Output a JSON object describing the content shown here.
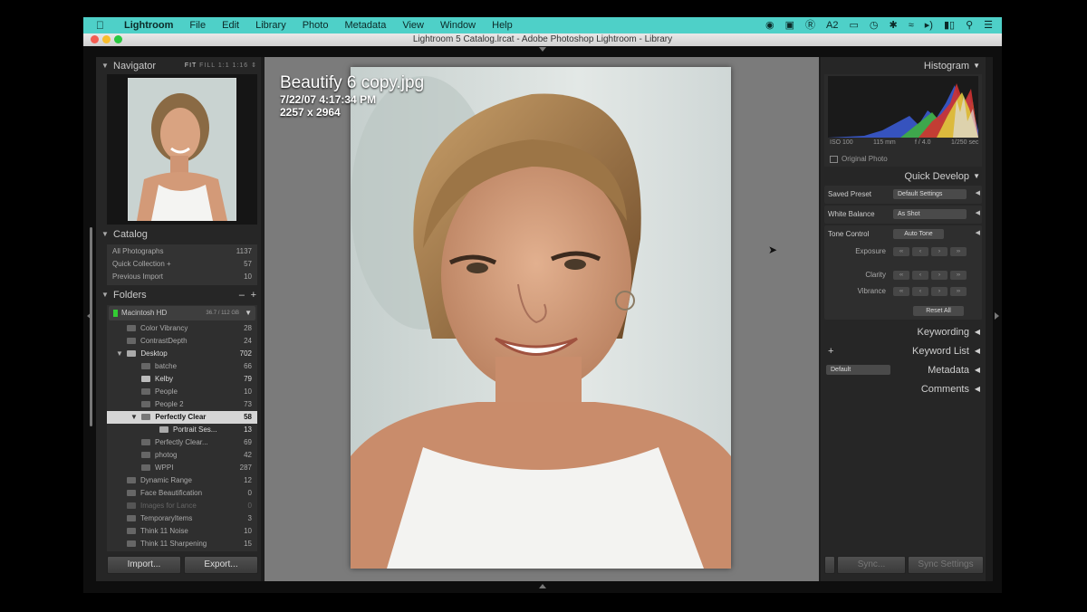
{
  "menubar": {
    "app": "Lightroom",
    "menus": [
      "File",
      "Edit",
      "Library",
      "Photo",
      "Metadata",
      "View",
      "Window",
      "Help"
    ],
    "status_number": "2"
  },
  "window": {
    "title": "Lightroom 5 Catalog.lrcat - Adobe Photoshop Lightroom - Library"
  },
  "navigator": {
    "title": "Navigator",
    "modes": [
      "FIT",
      "FILL",
      "1:1",
      "1:16"
    ]
  },
  "catalog": {
    "title": "Catalog",
    "items": [
      {
        "label": "All Photographs",
        "count": "1137"
      },
      {
        "label": "Quick Collection +",
        "count": "57"
      },
      {
        "label": "Previous Import",
        "count": "10"
      }
    ]
  },
  "folders": {
    "title": "Folders",
    "volume": {
      "label": "Macintosh HD",
      "size": "36.7 / 112 GB"
    },
    "items": [
      {
        "label": "Color Vibrancy",
        "count": "28"
      },
      {
        "label": "ContrastDepth",
        "count": "24"
      },
      {
        "label": "Desktop",
        "count": "702"
      },
      {
        "label": "batche",
        "count": "66"
      },
      {
        "label": "Kelby",
        "count": "79"
      },
      {
        "label": "People",
        "count": "10"
      },
      {
        "label": "People 2",
        "count": "73"
      },
      {
        "label": "Perfectly Clear",
        "count": "58"
      },
      {
        "label": "Portrait Ses...",
        "count": "13"
      },
      {
        "label": "Perfectly Clear...",
        "count": "69"
      },
      {
        "label": "photog",
        "count": "42"
      },
      {
        "label": "WPPI",
        "count": "287"
      },
      {
        "label": "Dynamic Range",
        "count": "12"
      },
      {
        "label": "Face Beautification",
        "count": "0"
      },
      {
        "label": "Images for Lance",
        "count": "0"
      },
      {
        "label": "TemporaryItems",
        "count": "3"
      },
      {
        "label": "Think 11 Noise",
        "count": "10"
      },
      {
        "label": "Think 11 Sharpening",
        "count": "15"
      }
    ]
  },
  "left_buttons": {
    "import": "Import...",
    "export": "Export..."
  },
  "photo": {
    "filename": "Beautify 6 copy.jpg",
    "date": "7/22/07 4:17:34 PM",
    "dimensions": "2257 x 2964"
  },
  "histogram": {
    "title": "Histogram",
    "iso": "ISO 100",
    "focal": "115 mm",
    "aperture": "f / 4.0",
    "shutter": "1/250 sec",
    "original_photo": "Original Photo"
  },
  "quick_develop": {
    "title": "Quick Develop",
    "saved_preset_label": "Saved Preset",
    "saved_preset_value": "Default Settings",
    "white_balance_label": "White Balance",
    "white_balance_value": "As Shot",
    "tone_control_label": "Tone Control",
    "auto_tone": "Auto Tone",
    "exposure": "Exposure",
    "clarity": "Clarity",
    "vibrance": "Vibrance",
    "reset_all": "Reset All"
  },
  "right_panels": {
    "keywording": "Keywording",
    "keyword_list": "Keyword List",
    "metadata": "Metadata",
    "metadata_preset": "Default",
    "comments": "Comments"
  },
  "right_buttons": {
    "sync": "Sync...",
    "sync_settings": "Sync Settings"
  }
}
